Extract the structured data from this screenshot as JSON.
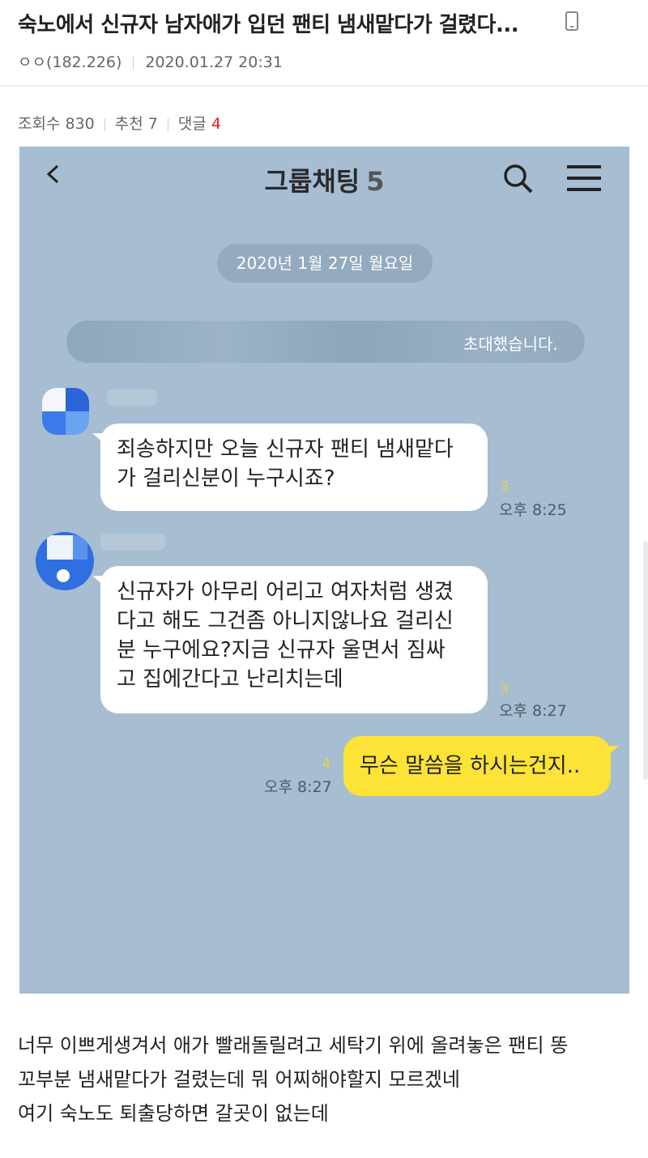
{
  "post": {
    "title": "숙노에서 신규자 남자애가 입던 팬티 냄새맡다가 걸렸다...",
    "author": "ㅇㅇ(182.226)",
    "date": "2020.01.27 20:31",
    "views_label": "조회수 830",
    "recommend_label": "추천 7",
    "comments_label": "댓글",
    "comments_count": "4",
    "body_lines": [
      "너무 이쁘게생겨서 애가 빨래돌릴려고 세탁기 위에 올려놓은 팬티 똥",
      "꼬부분 냄새맡다가 걸렸는데 뭐 어찌해야할지 모르겠네",
      "여기 숙노도 퇴출당하면 갈곳이 없는데"
    ]
  },
  "chat": {
    "title": "그룹채팅",
    "member_count": "5",
    "date_divider": "2020년 1월 27일 월요일",
    "invite_text": "초대했습니다.",
    "messages": [
      {
        "lines": [
          "죄송하지만 오늘 신규자 팬티 냄새맡다",
          "가 걸리신분이 누구시죠?"
        ],
        "unread": "3",
        "time": "오후 8:25"
      },
      {
        "lines": [
          "신규자가 아무리 어리고 여자처럼 생겼",
          "다고 해도 그건좀 아니지않나요 걸리신",
          "분 누구에요?지금 신규자 울면서 짐싸",
          "고 집에간다고 난리치는데"
        ],
        "unread": "3",
        "time": "오후 8:27"
      },
      {
        "lines": [
          "무슨 말씀을 하시는건지.."
        ],
        "unread": "4",
        "time": "오후 8:27"
      }
    ]
  },
  "colors": {
    "chat_background": "#a6bdd2",
    "my_bubble": "#fde238",
    "comment_count": "#dd2222"
  }
}
